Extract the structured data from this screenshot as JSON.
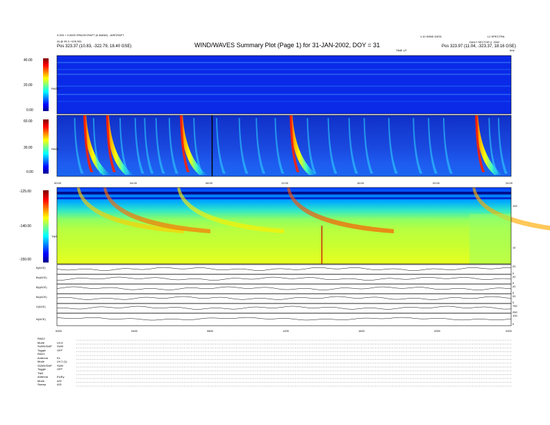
{
  "header": {
    "line1_left": "0.020 + 0.0000 SPACECRAFT (K-BAND) - AIRCRAFT",
    "line2_left": "At @ 99.3 +105 051",
    "pos_left": "Pos  323.37 (10.83, -322.79, 18.40 GSE)",
    "title": "WIND/WAVES Summary Plot (Page 1) for 31-JAN-2002, DOY = 31",
    "line1_mid": "1.10 WIND DATA",
    "line1_right": "L2 SPECTRA",
    "line2_right": "DAILY SECTOR 2, 2002",
    "pos_right": "Pos  323.97 (11.04, -323.37, 18.16 GSE)",
    "ut_label": "TIME UT",
    "khz_label": "kHz"
  },
  "chart_data": [
    {
      "type": "heatmap",
      "panel": "RAD2",
      "ylabel": "RAD2",
      "yticks": [
        "40.00",
        "20.00",
        "0.00"
      ],
      "yrange": [
        0,
        40
      ],
      "colormap": "jet"
    },
    {
      "type": "heatmap",
      "panel": "RAD1",
      "ylabel": "RAD1",
      "yticks": [
        "60.00",
        "30.00",
        "0.00"
      ],
      "yrange": [
        0,
        60
      ],
      "colormap": "jet",
      "xticks": [
        "00:00",
        "04:00",
        "08:00",
        "12:00",
        "16:00",
        "20:00",
        "24:00"
      ],
      "bursts_hours": [
        1.4,
        2.6,
        6.5,
        12.3,
        22.1
      ]
    },
    {
      "type": "heatmap",
      "panel": "TNR",
      "ylabel": "TNR",
      "yticks": [
        "-125.00",
        "-140.00",
        "-150.00"
      ],
      "yrange": [
        -155,
        -125
      ],
      "right_yticks": [
        "100",
        "10"
      ],
      "colormap": "jet"
    },
    {
      "type": "line",
      "panel": "MFI",
      "series": [
        {
          "name": "B(ACE)",
          "right_ticks": [
            "20",
            "0"
          ]
        },
        {
          "name": "Bx(ACE)",
          "right_ticks": [
            "20",
            "0"
          ]
        },
        {
          "name": "By(ACE)",
          "right_ticks": [
            "20",
            "0"
          ]
        },
        {
          "name": "Bz(ACE)",
          "right_ticks": [
            "20",
            "0"
          ]
        },
        {
          "name": "V(ACE)",
          "right_ticks": [
            "750",
            "250"
          ]
        },
        {
          "name": "N(ACE)",
          "right_ticks": [
            "100",
            "0"
          ]
        }
      ],
      "xticks": [
        "0000",
        "0400",
        "0800",
        "1200",
        "1600",
        "2000",
        "2400"
      ]
    }
  ],
  "footer": {
    "rows": [
      {
        "label": "RAD2",
        "value": ""
      },
      {
        "label": "Mode",
        "value": "LN 8"
      },
      {
        "label": "SUMX/DAP",
        "value": "SUM"
      },
      {
        "label": "Toggle",
        "value": "OFF"
      },
      {
        "label": "RAD1",
        "value": ""
      },
      {
        "label": "Antenna",
        "value": "Ex"
      },
      {
        "label": "Mode",
        "value": "LN 2 (1)"
      },
      {
        "label": "SUMX/DAP",
        "value": "SUM"
      },
      {
        "label": "Toggle",
        "value": "OFF"
      },
      {
        "label": "TNR",
        "value": ""
      },
      {
        "label": "Antenna",
        "value": "Ex/Ey"
      },
      {
        "label": "Mode",
        "value": "A/D"
      },
      {
        "label": "Sweep",
        "value": "A/D"
      }
    ]
  },
  "colors": {
    "background": "#ffffff",
    "jet_low": "#0000ff",
    "jet_high": "#ff0000"
  }
}
